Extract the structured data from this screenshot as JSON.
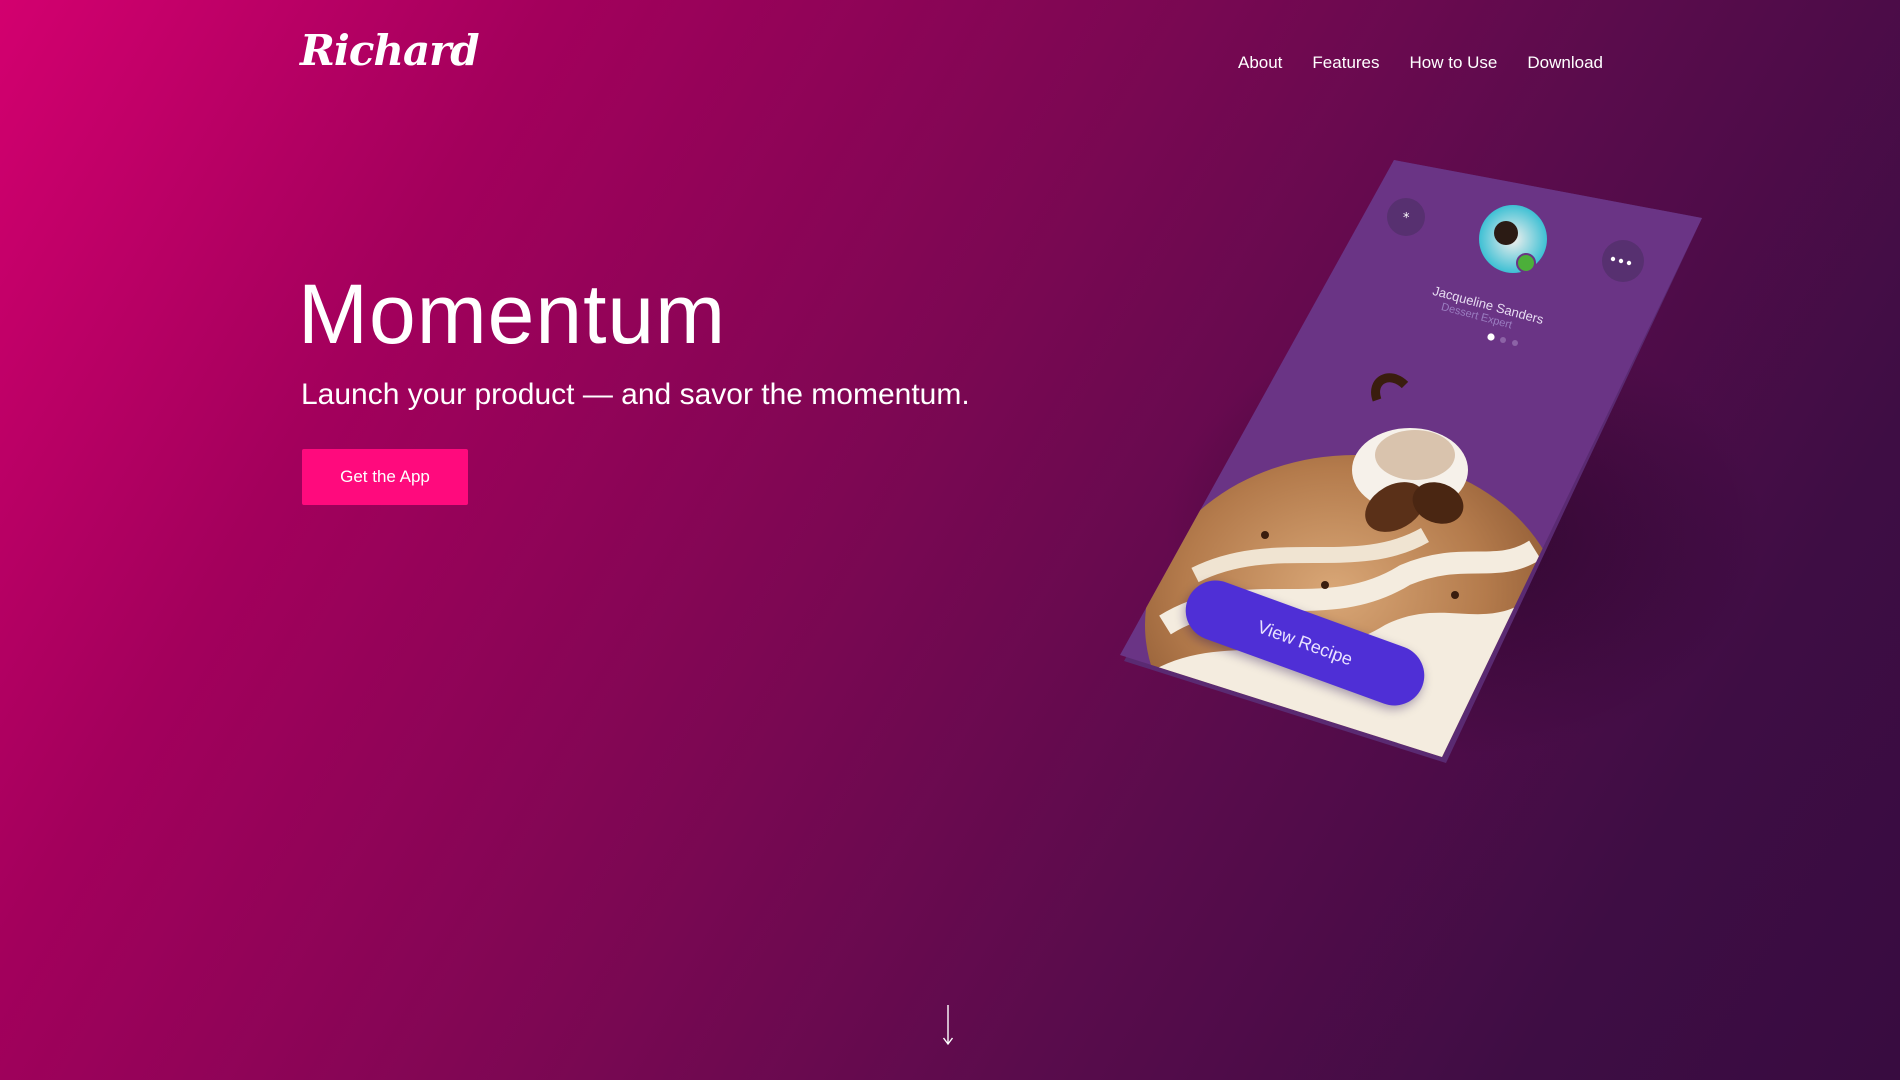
{
  "brand": {
    "logo_text": "Richard"
  },
  "nav": {
    "items": [
      "About",
      "Features",
      "How to Use",
      "Download"
    ]
  },
  "hero": {
    "title": "Momentum",
    "subtitle": "Launch your product — and savor the momentum.",
    "cta_label": "Get the App"
  },
  "phone": {
    "profile_name": "Jacqueline Sanders",
    "profile_role": "Dessert Expert",
    "carousel_dots": 3,
    "carousel_active": 1,
    "button_label": "View Recipe"
  },
  "icons": {
    "scroll": "arrow-down-icon",
    "menu": "more-dots-icon",
    "star": "asterisk-icon"
  },
  "colors": {
    "cta": "#ff0a7d",
    "phone_screen": "#6a3485",
    "recipe_button": "#4f2fd6",
    "status_online": "#4caf3a"
  }
}
